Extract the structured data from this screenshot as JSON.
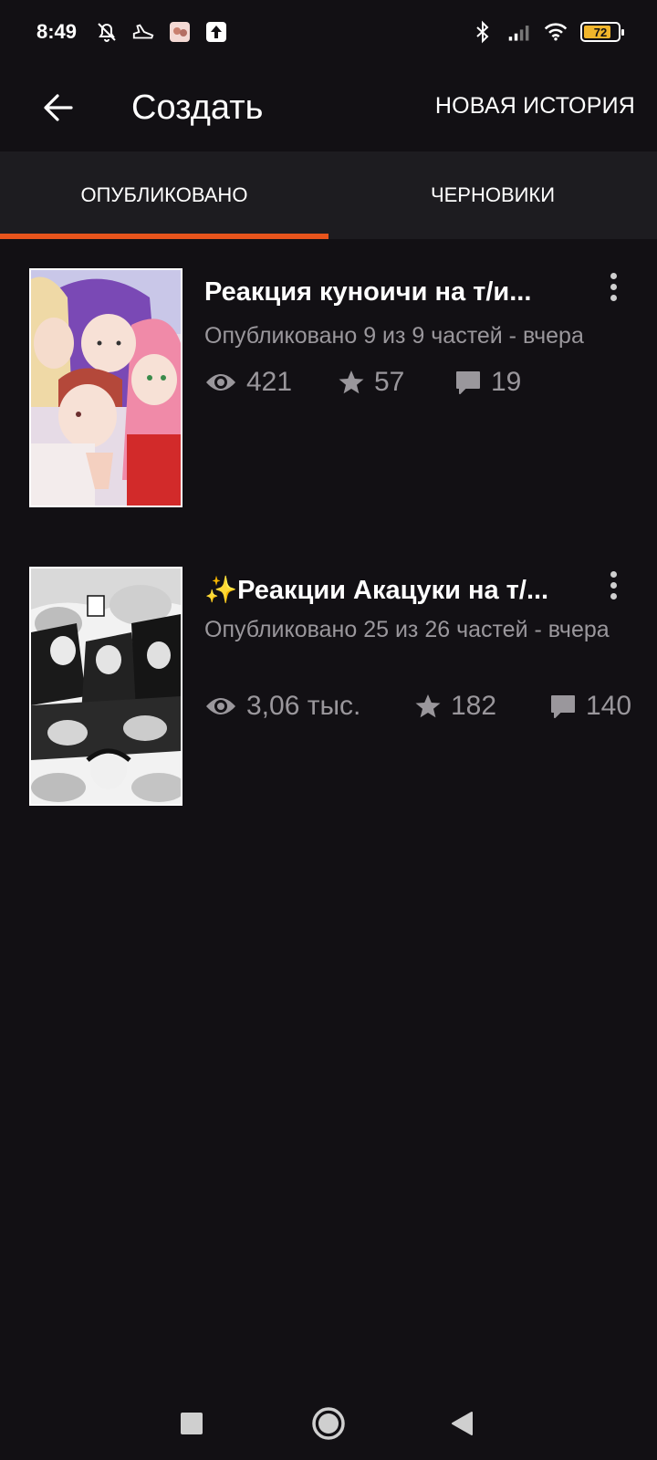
{
  "status_bar": {
    "time": "8:49",
    "battery_level": "72",
    "icons": [
      "mute-alarm-icon",
      "sneaker-icon",
      "app-thumbnail-icon",
      "upload-icon",
      "bluetooth-icon",
      "signal-icon",
      "wifi-icon",
      "battery-icon"
    ]
  },
  "app_bar": {
    "title": "Создать",
    "action_label": "НОВАЯ ИСТОРИЯ",
    "back_icon": "arrow-left-icon"
  },
  "tabs": [
    {
      "label": "ОПУБЛИКОВАНО",
      "active": true
    },
    {
      "label": "ЧЕРНОВИКИ",
      "active": false
    }
  ],
  "stories": [
    {
      "title": "Реакция куноичи на т/и...",
      "meta": "Опубликовано 9 из 9 частей - вчера",
      "views": "421",
      "votes": "57",
      "comments": "19",
      "cover": "color manga illustration"
    },
    {
      "title": "✨Реакции Акацуки на т/...",
      "meta": "Опубликовано 25 из 26 частей - вчера",
      "views": "3,06 тыс.",
      "votes": "182",
      "comments": "140",
      "cover": "black and white manga illustration"
    }
  ],
  "nav_bar": {
    "buttons": [
      "recents-square-icon",
      "home-circle-icon",
      "back-triangle-icon"
    ]
  },
  "colors": {
    "background": "#121014",
    "tab_bar": "#1d1c20",
    "accent": "#e8541c",
    "secondary_text": "#9a979c"
  }
}
